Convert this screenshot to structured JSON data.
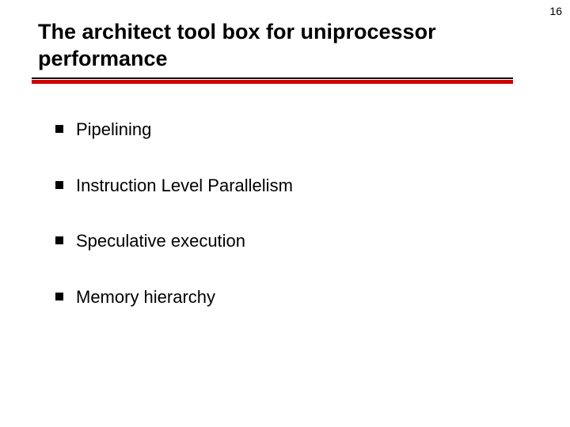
{
  "page_number": "16",
  "title": "The architect tool box for uniprocessor performance",
  "bullets": [
    "Pipelining",
    "Instruction Level Parallelism",
    "Speculative execution",
    "Memory hierarchy"
  ],
  "colors": {
    "accent_red": "#d00000"
  }
}
